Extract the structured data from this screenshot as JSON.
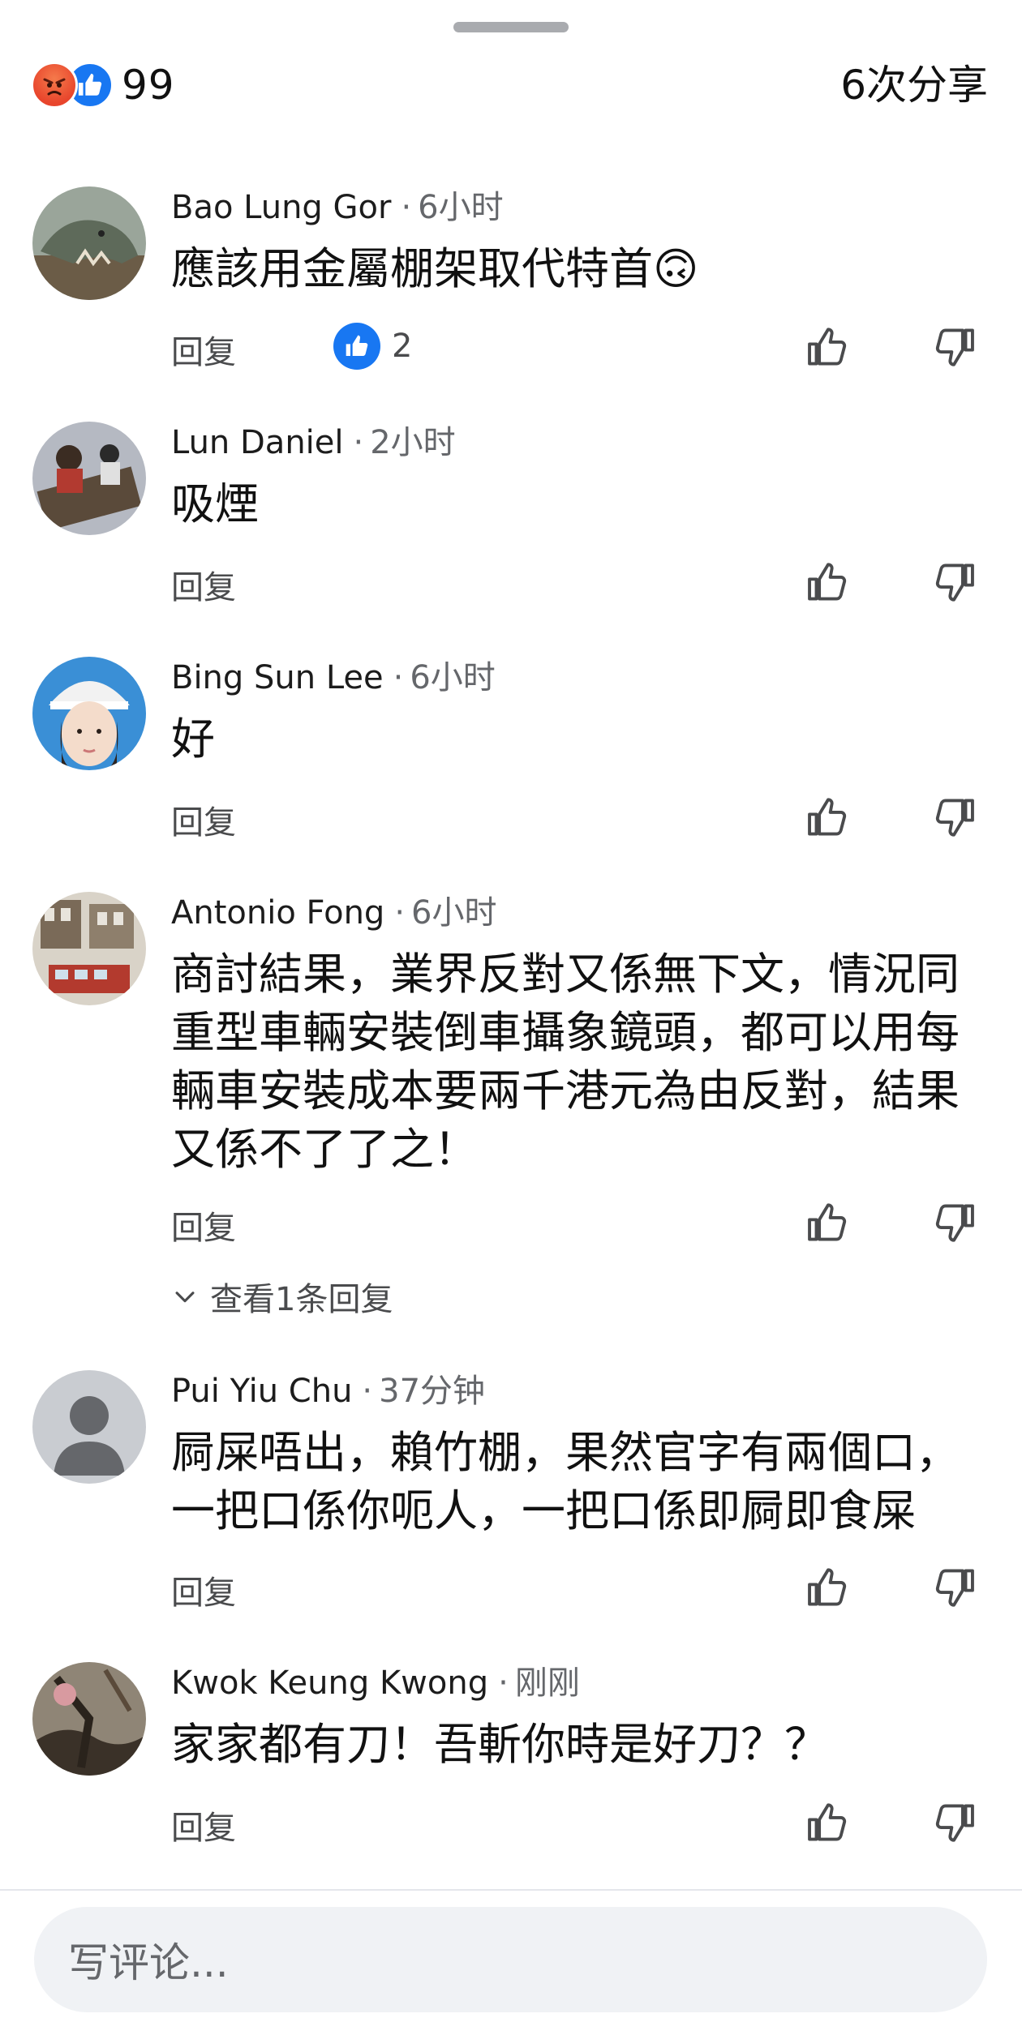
{
  "header": {
    "reaction_count": "99",
    "shares": "6次分享",
    "reaction_icons": [
      "angry-icon",
      "like-icon"
    ]
  },
  "comments": [
    {
      "name": "Bao Lung Gor",
      "time": "6小时",
      "text": "應該用金屬棚架取代特首🙃",
      "reply": "回复",
      "likes": "2",
      "avatar_color": "#6f7b6a"
    },
    {
      "name": "Lun Daniel",
      "time": "2小时",
      "text": "吸煙",
      "reply": "回复",
      "avatar_color": "#8a7560"
    },
    {
      "name": "Bing Sun Lee",
      "time": "6小时",
      "text": "好",
      "reply": "回复",
      "avatar_color": "#3a7fc4"
    },
    {
      "name": "Antonio Fong",
      "time": "6小时",
      "text": "商討結果，業界反對又係無下文，情況同重型車輛安裝倒車攝象鏡頭，都可以用每輛車安裝成本要兩千港元為由反對，結果又係不了了之！",
      "reply": "回复",
      "view_replies": "查看1条回复",
      "avatar_color": "#9a8c7a"
    },
    {
      "name": "Pui Yiu Chu",
      "time": "37分钟",
      "text": "屙屎唔出，賴竹棚，果然官字有兩個口，一把口係你呃人，一把口係即屙即食屎",
      "reply": "回复",
      "avatar_color": "#c9ccd1"
    },
    {
      "name": "Kwok Keung Kwong",
      "time": "刚刚",
      "text": "家家都有刀！吾斬你時是好刀？？",
      "reply": "回复",
      "avatar_color": "#4b4036"
    }
  ],
  "composer": {
    "placeholder": "写评论..."
  },
  "colors": {
    "accent": "#1877f2",
    "angry": "#e8452c",
    "muted": "#65676b"
  }
}
